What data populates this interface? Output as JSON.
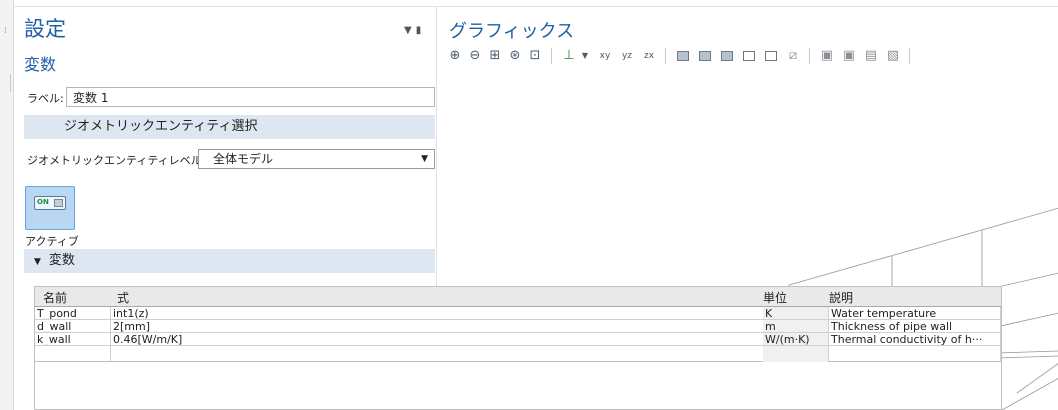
{
  "settings": {
    "title": "設定",
    "node_name": "変数",
    "label_field": {
      "label": "ラベル:",
      "value": "変数 1"
    },
    "geometric_entity_section": "ジオメトリックエンティティ選択",
    "entity_level": {
      "label": "ジオメトリックエンティティレベル:",
      "value": "全体モデル"
    },
    "active_toggle": {
      "switch_text": "ON",
      "label": "アクティブ"
    },
    "variables_section": "変数"
  },
  "variables_table": {
    "headers": {
      "name": "名前",
      "expression": "式",
      "unit": "単位",
      "description": "説明"
    },
    "rows": [
      {
        "name": "T_pond",
        "expression": "int1(z)",
        "unit": "K",
        "description": "Water temperature"
      },
      {
        "name": "d_wall",
        "expression": "2[mm]",
        "unit": "m",
        "description": "Thickness of pipe wall"
      },
      {
        "name": "k_wall",
        "expression": "0.46[W/m/K]",
        "unit": "W/(m·K)",
        "description": "Thermal conductivity of h···"
      },
      {
        "name": "",
        "expression": "",
        "unit": "",
        "description": ""
      }
    ]
  },
  "graphics": {
    "title": "グラフィックス",
    "toolbar_icons": [
      "zoom-in-icon",
      "zoom-out-icon",
      "zoom-box-icon",
      "zoom-selected-icon",
      "zoom-extents-icon",
      "go-to-view-icon",
      "xy-view-icon",
      "yz-view-icon",
      "zx-view-icon",
      "wireframe-icon",
      "render-icon",
      "transparency-icon",
      "select-box-icon",
      "hide-icon",
      "clear-selection-icon",
      "scene-light-icon",
      "image-snapshot-icon",
      "print-icon",
      "reset-view-icon"
    ]
  }
}
